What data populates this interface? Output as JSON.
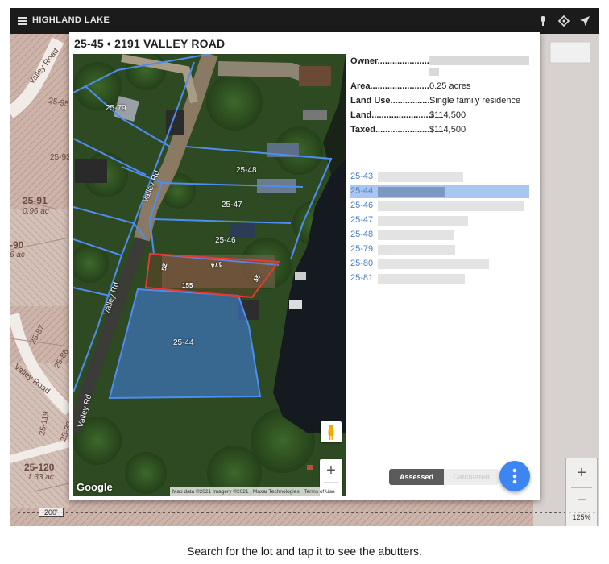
{
  "app": {
    "title": "HIGHLAND LAKE",
    "icons": [
      "menu-icon",
      "pin-icon",
      "locate-icon",
      "navigate-icon"
    ]
  },
  "background_map": {
    "lots": [
      {
        "id": "25-91",
        "area": "0.96 ac"
      },
      {
        "id": "25-120",
        "area": "1.33 ac"
      }
    ],
    "partial_lots": [
      {
        "id": "-90",
        "area": "6 ac"
      }
    ],
    "small_lots": [
      "25-95",
      "25-93",
      "25-87",
      "25-86",
      "25-119",
      "25-36"
    ],
    "roads": [
      "Valley Road",
      "Valley Road"
    ],
    "scale_label": "200'",
    "zoom_percent": "125%"
  },
  "lot_card": {
    "title": "25-45 • 2191 VALLEY ROAD",
    "details": [
      {
        "key": "Owner.......................",
        "value": ""
      },
      {
        "key": "Area........................",
        "value": "0.25 acres"
      },
      {
        "key": "Land Use.................",
        "value": "Single family residence"
      },
      {
        "key": "Land.........................",
        "value": "$114,500"
      },
      {
        "key": "Taxed......................",
        "value": "$114,500"
      }
    ],
    "abutters": [
      {
        "id": "25-43",
        "selected": false
      },
      {
        "id": "25-44",
        "selected": true
      },
      {
        "id": "25-46",
        "selected": false
      },
      {
        "id": "25-47",
        "selected": false
      },
      {
        "id": "25-48",
        "selected": false
      },
      {
        "id": "25-79",
        "selected": false
      },
      {
        "id": "25-80",
        "selected": false
      },
      {
        "id": "25-81",
        "selected": false
      }
    ],
    "toggle": {
      "on": "Assessed",
      "off": "Calculated"
    },
    "fab_icon": "more-vert-icon"
  },
  "aerial_map": {
    "lot_labels": [
      "25-79",
      "25-48",
      "25-47",
      "25-46",
      "25-44"
    ],
    "dim_labels": [
      "155",
      "174",
      "55",
      "52"
    ],
    "road_label": "Valley Rd",
    "attribution": [
      "Map data ©2021 Imagery ©2021 , Maxar Technologies",
      "Terms of Use"
    ],
    "logo": "Google",
    "zoom_in": "+",
    "zoom_out": "−"
  },
  "colors": {
    "parcel_outline": "#4f8df0",
    "selected_lot": "#e53935",
    "abutter_fill": "#3f7bd8",
    "link": "#4a7fc4",
    "fab": "#3d86f2"
  },
  "caption": "Search for the lot and tap it to see the abutters."
}
